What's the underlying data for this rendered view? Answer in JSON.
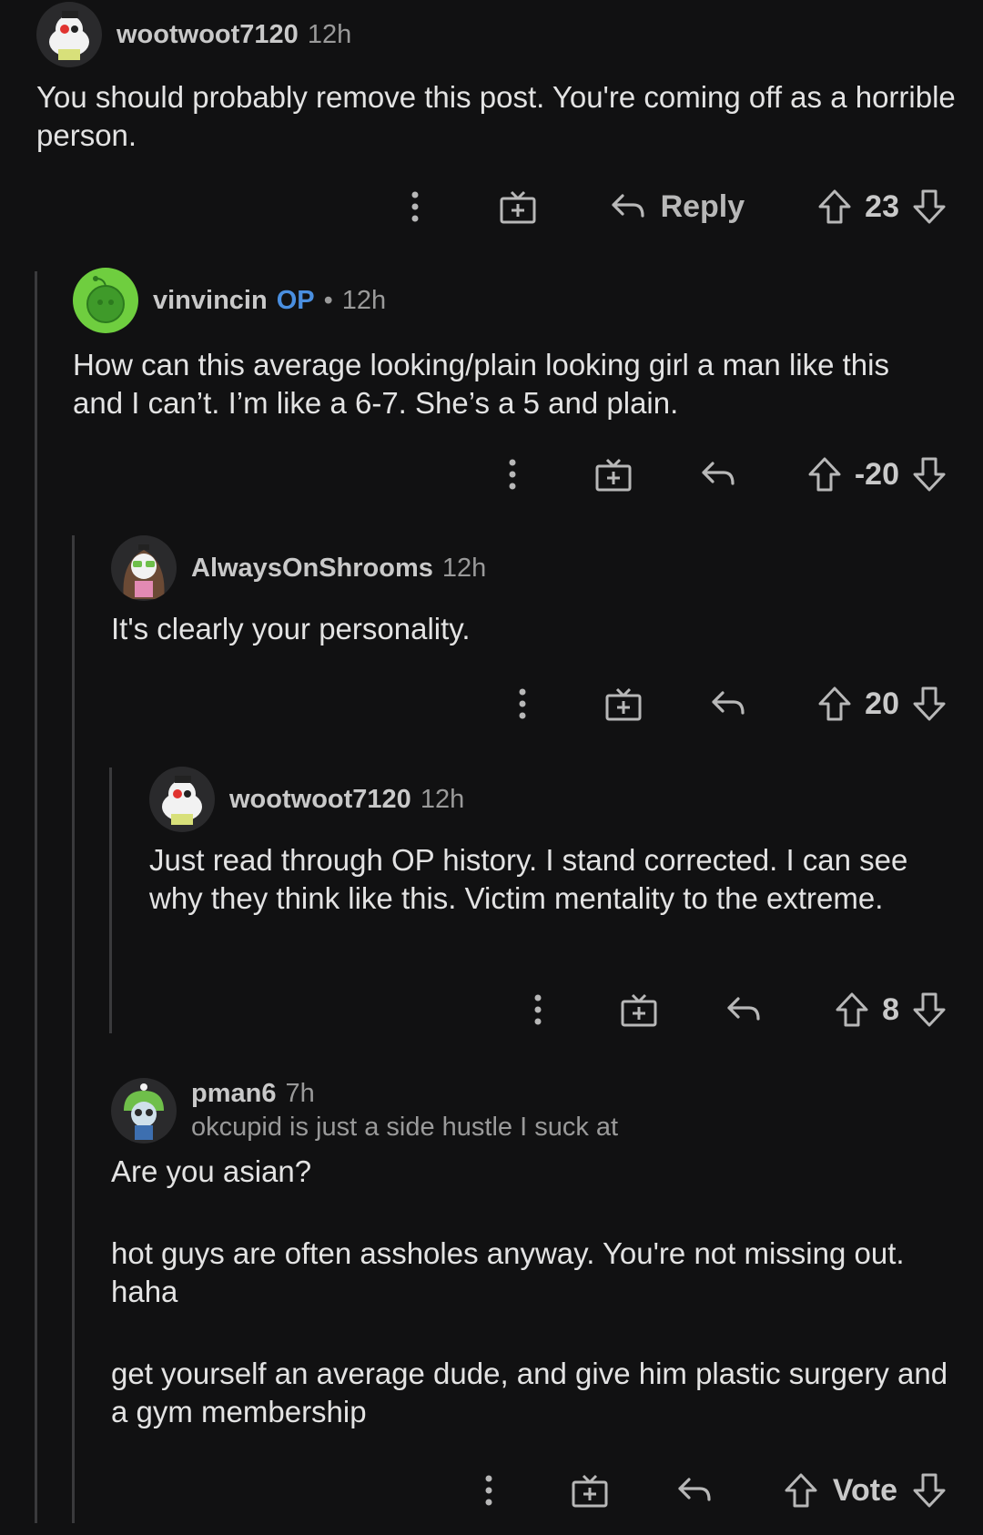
{
  "comments": [
    {
      "username": "wootwoot7120",
      "time": "12h",
      "body": [
        "You should probably remove this post. You're coming off as a horrible person."
      ],
      "score": "23",
      "reply_label": "Reply"
    },
    {
      "username": "vinvincin",
      "op_badge": "OP",
      "separator": "•",
      "time": "12h",
      "body": [
        "How can this average looking/plain looking girl  a man like this and I can’t. I’m like a 6-7. She’s a 5 and plain."
      ],
      "score": "-20"
    },
    {
      "username": "AlwaysOnShrooms",
      "time": "12h",
      "body": [
        "It's clearly your personality."
      ],
      "score": "20"
    },
    {
      "username": "wootwoot7120",
      "time": "12h",
      "body": [
        "Just read through OP history. I stand corrected. I can see why they think like this. Victim mentality to the extreme."
      ],
      "score": "8"
    },
    {
      "username": "pman6",
      "time": "7h",
      "flair": "okcupid is just a side hustle I suck at",
      "body": [
        "Are you asian?",
        "hot guys are often assholes anyway. You're not missing out. haha",
        "get yourself an average dude, and give him plastic surgery and a gym membership"
      ],
      "vote_label": "Vote"
    }
  ],
  "icons": {
    "more": "more-options-icon",
    "award": "award-gift-icon",
    "reply": "reply-arrow-icon",
    "upvote": "upvote-arrow-icon",
    "downvote": "downvote-arrow-icon"
  },
  "colors": {
    "background": "#111112",
    "op_badge": "#4a8fe0",
    "thread_line": "#3a3a3c",
    "text": "#e3e3e3",
    "meta": "#9a9a9a"
  }
}
